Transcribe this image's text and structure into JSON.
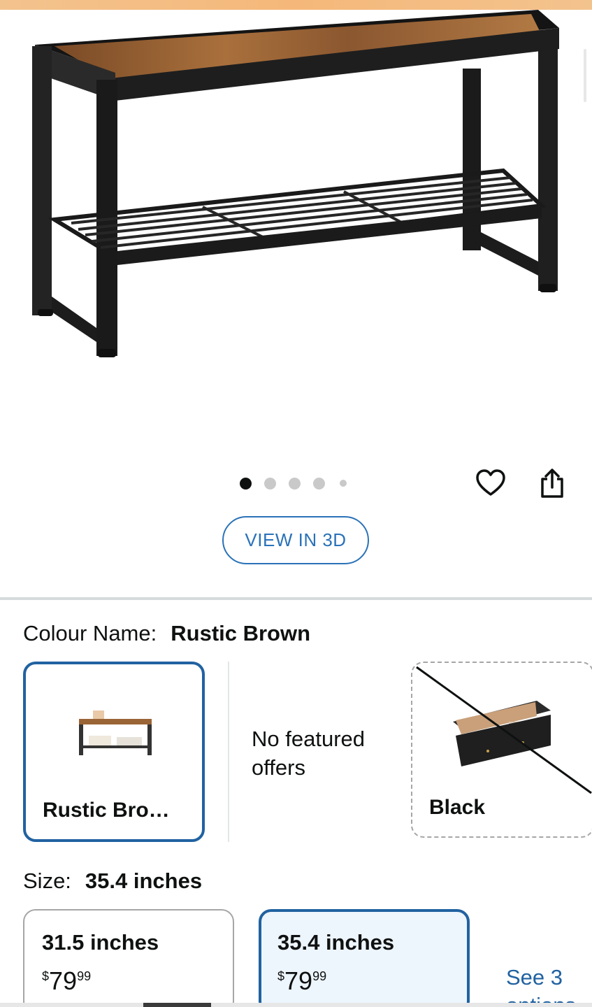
{
  "gallery": {
    "image_alt": "Rustic brown wooden top shoe bench with black metal frame",
    "dots_total": 5,
    "active_dot": 1,
    "icons": {
      "wishlist": "heart-icon",
      "share": "share-icon"
    },
    "view_3d_label": "VIEW IN 3D"
  },
  "colour": {
    "label": "Colour Name:",
    "selected": "Rustic Brown",
    "options": [
      {
        "label": "Rustic Bro…",
        "state": "selected"
      },
      {
        "label": "No featured offers",
        "state": "info"
      },
      {
        "label": "Black",
        "state": "unavailable"
      }
    ]
  },
  "size": {
    "label": "Size:",
    "selected": "35.4 inches",
    "options": [
      {
        "name": "31.5 inches",
        "price_symbol": "$",
        "price_whole": "79",
        "price_fraction": "99",
        "state": "normal"
      },
      {
        "name": "35.4 inches",
        "price_symbol": "$",
        "price_whole": "79",
        "price_fraction": "99",
        "state": "selected"
      }
    ],
    "see_more_line1": "See 3",
    "see_more_line2": "options"
  },
  "colors": {
    "accent_blue": "#2162a1",
    "link_blue": "#2a72b8",
    "selected_bg": "#edf5fd"
  }
}
